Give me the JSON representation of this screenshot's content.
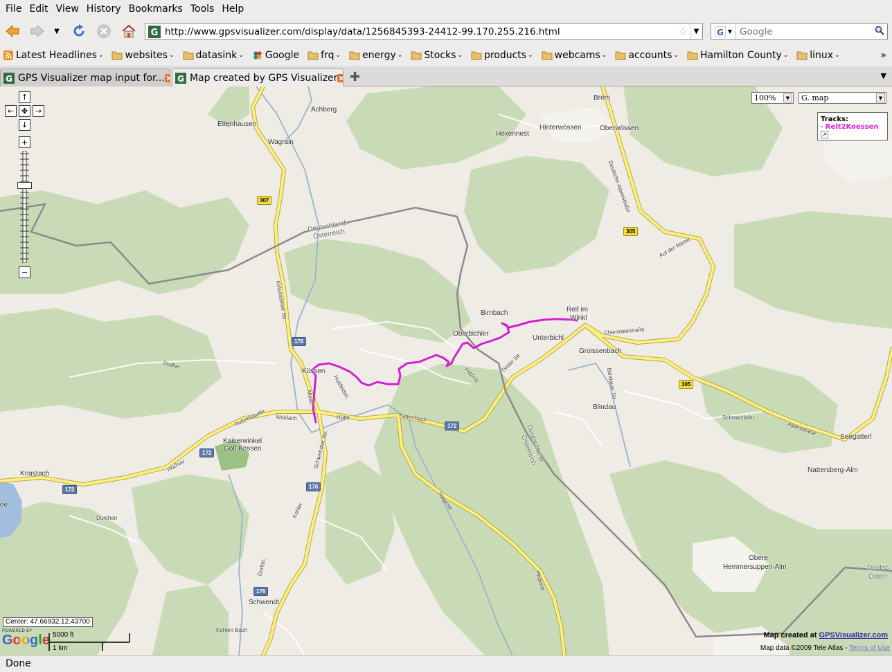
{
  "menu": [
    "File",
    "Edit",
    "View",
    "History",
    "Bookmarks",
    "Tools",
    "Help"
  ],
  "nav": {
    "url": "http://www.gpsvisualizer.com/display/data/1256845393-24412-99.170.255.216.html",
    "search_placeholder": "Google"
  },
  "bookmarks": {
    "items": [
      {
        "label": "Latest Headlines",
        "icon": "rss-icon"
      },
      {
        "label": "websites",
        "icon": "folder-icon"
      },
      {
        "label": "datasink",
        "icon": "folder-icon"
      },
      {
        "label": "Google",
        "icon": "google-icon"
      },
      {
        "label": "frq",
        "icon": "folder-icon"
      },
      {
        "label": "energy",
        "icon": "folder-icon"
      },
      {
        "label": "Stocks",
        "icon": "folder-icon"
      },
      {
        "label": "products",
        "icon": "folder-icon"
      },
      {
        "label": "webcams",
        "icon": "folder-icon"
      },
      {
        "label": "accounts",
        "icon": "folder-icon"
      },
      {
        "label": "Hamilton County",
        "icon": "folder-icon"
      },
      {
        "label": "linux",
        "icon": "folder-icon"
      }
    ],
    "more": "»"
  },
  "tabs": [
    {
      "label": "GPS Visualizer map input for...",
      "active": false
    },
    {
      "label": "Map created by GPS Visualizer",
      "active": true
    }
  ],
  "map": {
    "zoom_select": "100%",
    "type_select": "G. map",
    "tracks_title": "Tracks:",
    "track_prefix": "- ",
    "track_name": "Reit2Koessen",
    "track_color": "#d020d0",
    "center": "Center: 47.66932,12.43700",
    "powered_by": "POWERED BY",
    "google": "Google",
    "scale_ft": "5000 ft",
    "scale_km": "1 km",
    "credit_prefix": "Map created at ",
    "credit_link": "GPSVisualizer.com",
    "mapdata": "Map data ©2009 Tele Atlas - ",
    "terms": "Terms of Use",
    "places": {
      "brem": "Brem",
      "achberg": "Achberg",
      "ettenhausen": "Ettenhausen",
      "wagrain": "Wagrain",
      "hexennest": "Hexennest",
      "hinterwoessen": "Hinterwössen",
      "oberwoessen": "Oberwössen",
      "deutschland": "Deutschland",
      "oesterreich": "Österreich",
      "deutschland2": "Deutschland",
      "oesterreich2": "Österreich",
      "deutschland3": "Deutsc",
      "oesterreich3": "Österr",
      "birnbach": "Birnbach",
      "reit1": "Reit im",
      "reit2": "Winkl",
      "oberbichler": "Oberbichler",
      "unterbichl": "Unterbichl",
      "groissenbach": "Groissenbach",
      "koessen": "Kössen",
      "staffen": "Staffen",
      "blindau": "Blindau",
      "kaiserwinkel1": "Kaiserwinkel",
      "kaiserwinkel2": "Golf Kössen",
      "kranzach": "Kranzach",
      "durchen": "Durchen",
      "schwendt": "Schwendt",
      "kohlenbach": "Kohlen Bach",
      "schwarzlofer": "Schwarzlofer",
      "seegatterl": "Seegatterl",
      "nattersberg": "Nattersberg-Alm",
      "obere1": "Obere",
      "obere2": "Hemmersuppen-Alm",
      "ee": "ee"
    },
    "streets": {
      "chiemsee": "Chiemseestraße",
      "alpen": "Alpenstraße",
      "aufdermaser": "Auf der Maser",
      "deutschealpen": "Deutsche Alpenstraße",
      "tiroler": "Tiroler Str",
      "kaltenbach": "Kaltenbach",
      "huette": "Hütte",
      "waidach": "Waidach",
      "ausserkapelle": "Außerkapelle",
      "hochau": "Hochau",
      "hagerstr": "Hagerstr",
      "hagerstr2": "Hagerstr",
      "schwendter": "Schwendter Str.",
      "kohler": "Kohler",
      "dorfstr": "Dorfstr.",
      "huettfeld": "Huttfeldstr.",
      "allee": "Allestr.",
      "kobel": "Kobelsteiner Str.",
      "fritzing": "Fritzing",
      "blindauer": "Blindauer Str"
    },
    "shields": {
      "s307": "307",
      "s305a": "305",
      "s305b": "305",
      "s176a": "176",
      "s176b": "176",
      "s176c": "176",
      "s172a": "172",
      "s172b": "172",
      "s172c": "172"
    }
  },
  "status": "Done"
}
